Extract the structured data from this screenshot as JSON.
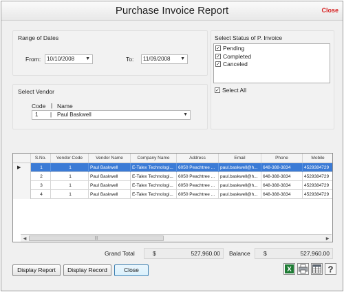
{
  "window": {
    "title": "Purchase Invoice Report",
    "close_label": "Close"
  },
  "dates": {
    "group_title": "Range of Dates",
    "from_label": "From:",
    "from_value": "10/10/2008",
    "to_label": "To:",
    "to_value": "11/09/2008"
  },
  "status": {
    "group_title": "Select Status of P. Invoice",
    "options": [
      {
        "label": "Pending",
        "checked": true
      },
      {
        "label": "Completed",
        "checked": true
      },
      {
        "label": "Canceled",
        "checked": true
      }
    ],
    "select_all_label": "Select All",
    "select_all_checked": true
  },
  "vendor": {
    "group_title": "Select Vendor",
    "code_header": "Code",
    "separator": "|",
    "name_header": "Name",
    "selected_code": "1",
    "selected_name": "Paul Baskwell"
  },
  "grid": {
    "columns": [
      "S.No.",
      "Vendor Code",
      "Vendor Name",
      "Company Name",
      "Address",
      "Email",
      "Phone",
      "Mobile"
    ],
    "rows": [
      [
        "1",
        "1",
        "Paul Baskwell",
        "E-Talex Technologi...",
        "6050 Peachtree ...",
        "paul.baskwell@h...",
        "648-388-3834",
        "4529384729"
      ],
      [
        "2",
        "1",
        "Paul Baskwell",
        "E-Talex Technologi...",
        "6050 Peachtree ...",
        "paul.baskwell@h...",
        "648-388-3834",
        "4529384729"
      ],
      [
        "3",
        "1",
        "Paul Baskwell",
        "E-Talex Technologi...",
        "6050 Peachtree ...",
        "paul.baskwell@h...",
        "648-388-3834",
        "4529384729"
      ],
      [
        "4",
        "1",
        "Paul Baskwell",
        "E-Talex Technologi...",
        "6050 Peachtree ...",
        "paul.baskwell@h...",
        "648-388-3834",
        "4529384729"
      ]
    ],
    "current_row_marker": "▶"
  },
  "totals": {
    "grand_total_label": "Grand Total",
    "grand_total_currency": "$",
    "grand_total_value": "527,960.00",
    "balance_label": "Balance",
    "balance_currency": "$",
    "balance_value": "527,960.00"
  },
  "buttons": {
    "display_report": "Display Report",
    "display_record": "Display Record",
    "close": "Close"
  },
  "toolbar_icons": [
    "excel-export-icon",
    "print-icon",
    "grid-layout-icon",
    "help-icon"
  ]
}
